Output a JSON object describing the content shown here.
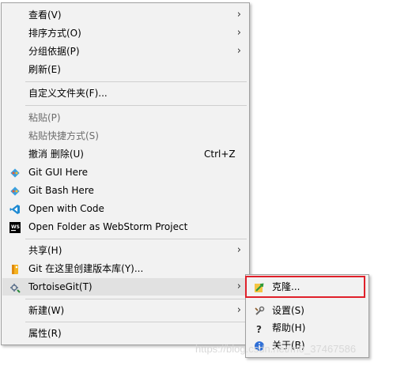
{
  "menu": {
    "items": [
      {
        "label": "查看(V)",
        "icon": "",
        "arrow": true
      },
      {
        "label": "排序方式(O)",
        "icon": "",
        "arrow": true
      },
      {
        "label": "分组依据(P)",
        "icon": "",
        "arrow": true
      },
      {
        "label": "刷新(E)",
        "icon": ""
      },
      {
        "label": "自定义文件夹(F)...",
        "icon": ""
      },
      {
        "label": "粘贴(P)",
        "icon": "",
        "disabled": true
      },
      {
        "label": "粘贴快捷方式(S)",
        "icon": "",
        "disabled": true
      },
      {
        "label": "撤消 删除(U)",
        "icon": "",
        "shortcut": "Ctrl+Z"
      },
      {
        "label": "Git GUI Here",
        "icon": "git-diamond-icon"
      },
      {
        "label": "Git Bash Here",
        "icon": "git-diamond-icon"
      },
      {
        "label": "Open with Code",
        "icon": "vscode-icon"
      },
      {
        "label": "Open Folder as WebStorm Project",
        "icon": "webstorm-icon"
      },
      {
        "label": "共享(H)",
        "icon": "",
        "arrow": true
      },
      {
        "label": "Git 在这里创建版本库(Y)...",
        "icon": "tortoisegit-create-repo-icon"
      },
      {
        "label": "TortoiseGit(T)",
        "icon": "tortoisegit-icon",
        "arrow": true,
        "highlighted": true
      },
      {
        "label": "新建(W)",
        "icon": "",
        "arrow": true
      },
      {
        "label": "属性(R)",
        "icon": ""
      }
    ],
    "undo_shortcut": "Ctrl+Z"
  },
  "submenu": {
    "items": [
      {
        "label": "克隆...",
        "icon": "clone-icon"
      },
      {
        "label": "设置(S)",
        "icon": "settings-wrench-icon"
      },
      {
        "label": "帮助(H)",
        "icon": "help-icon"
      },
      {
        "label": "关于(B)",
        "icon": "info-icon"
      }
    ]
  },
  "watermark": "https://blog.csdn.net/m0_37467586",
  "colors": {
    "highlight_box": "#e0202a",
    "menu_bg": "#f2f2f2"
  }
}
